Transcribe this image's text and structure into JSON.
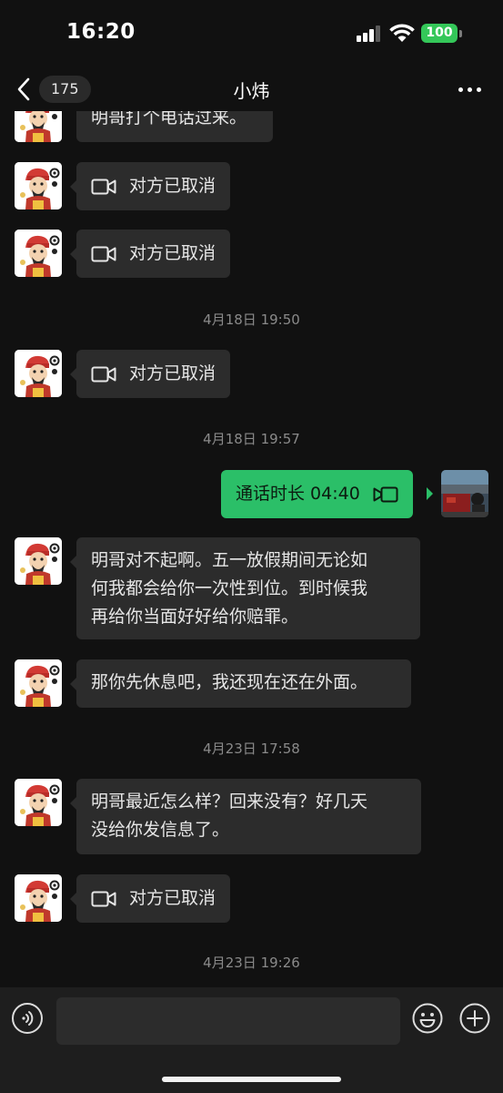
{
  "status_bar": {
    "time": "16:20",
    "battery": "100"
  },
  "nav": {
    "unread_count": "175",
    "title": "小炜"
  },
  "messages": [
    {
      "type": "text",
      "side": "left",
      "text": "明哥打个电话过来。"
    },
    {
      "type": "call",
      "side": "left",
      "text": "对方已取消"
    },
    {
      "type": "call",
      "side": "left",
      "text": "对方已取消"
    },
    {
      "type": "time",
      "text": "4月18日 19:50"
    },
    {
      "type": "call",
      "side": "left",
      "text": "对方已取消"
    },
    {
      "type": "time",
      "text": "4月18日 19:57"
    },
    {
      "type": "call",
      "side": "right",
      "text": "通话时长 04:40"
    },
    {
      "type": "text",
      "side": "left",
      "lines": [
        "明哥对不起啊。五一放假期间无论如",
        "何我都会给你一次性到位。到时候我",
        "再给你当面好好给你赔罪。"
      ]
    },
    {
      "type": "text",
      "side": "left",
      "text": "那你先休息吧，我还现在还在外面。"
    },
    {
      "type": "time",
      "text": "4月23日 17:58"
    },
    {
      "type": "text",
      "side": "left",
      "lines": [
        "明哥最近怎么样？回来没有？好几天",
        "没给你发信息了。"
      ]
    },
    {
      "type": "call",
      "side": "left",
      "text": "对方已取消"
    },
    {
      "type": "time",
      "text": "4月23日 19:26"
    }
  ],
  "input": {
    "placeholder": ""
  },
  "icons": {
    "back": "chevron-left-icon",
    "more": "more-dots-icon",
    "video_call": "video-camera-icon",
    "voice": "voice-input-icon",
    "emoji": "smiley-icon",
    "plus": "plus-icon"
  },
  "colors": {
    "background": "#111111",
    "bubble": "#2c2c2c",
    "my_bubble": "#2bbf68",
    "battery": "#34c759"
  }
}
